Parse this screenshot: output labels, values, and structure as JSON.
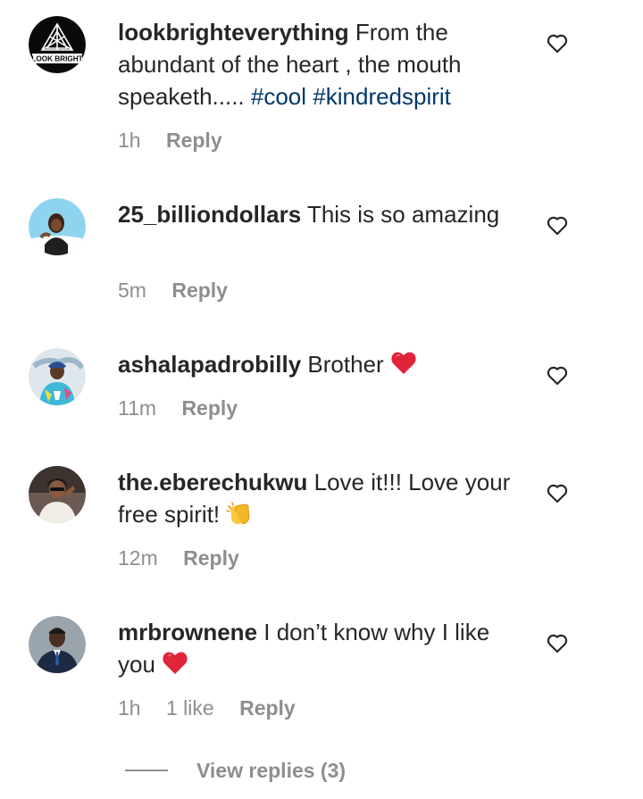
{
  "colors": {
    "text": "#262626",
    "muted": "#8e8e8e",
    "hashtag": "#00376b",
    "heart_emoji": "#e0243a"
  },
  "comments": [
    {
      "username": "lookbrighteverything",
      "text": "From the abundant of the heart , the mouth speaketh.....",
      "hashtags": [
        "#cool",
        "#kindredspirit"
      ],
      "time": "1h",
      "reply": "Reply",
      "avatar_logo_text": "LOOK BRIGHT"
    },
    {
      "username": "25_billiondollars",
      "text": "This is so amazing",
      "time": "5m",
      "reply": "Reply"
    },
    {
      "username": "ashalapadrobilly",
      "text": "Brother",
      "emoji": "red-heart",
      "time": "11m",
      "reply": "Reply"
    },
    {
      "username": "the.eberechukwu",
      "text": "Love it!!! Love your free spirit!",
      "emoji": "clapping-hands",
      "time": "12m",
      "reply": "Reply"
    },
    {
      "username": "mrbrownene",
      "text": "I don’t know why I like you",
      "emoji": "red-heart",
      "time": "1h",
      "likes": "1 like",
      "reply": "Reply"
    }
  ],
  "view_replies": "View replies (3)"
}
